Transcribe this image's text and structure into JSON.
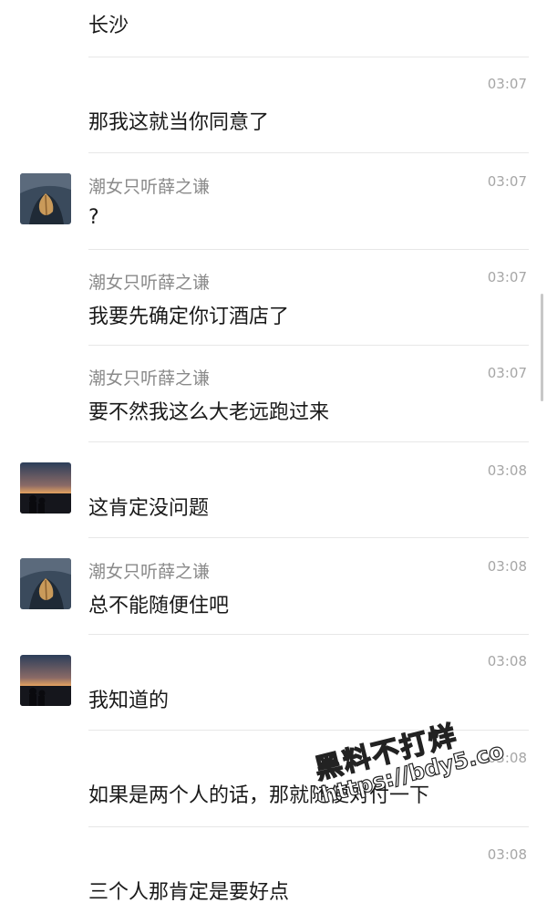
{
  "messages": [
    {
      "id": "m1",
      "avatar": "",
      "name": "",
      "time": "",
      "text": "长沙"
    },
    {
      "id": "m2",
      "avatar": "",
      "name": "",
      "time": "03:07",
      "text": "那我这就当你同意了"
    },
    {
      "id": "m3",
      "avatar": "leaf",
      "name": "潮女只听薛之谦",
      "time": "03:07",
      "text": "?"
    },
    {
      "id": "m4",
      "avatar": "",
      "name": "潮女只听薛之谦",
      "time": "03:07",
      "text": "我要先确定你订酒店了"
    },
    {
      "id": "m5",
      "avatar": "",
      "name": "潮女只听薛之谦",
      "time": "03:07",
      "text": "要不然我这么大老远跑过来"
    },
    {
      "id": "m6",
      "avatar": "sunset",
      "name": "",
      "time": "03:08",
      "text": "这肯定没问题"
    },
    {
      "id": "m7",
      "avatar": "leaf",
      "name": "潮女只听薛之谦",
      "time": "03:08",
      "text": "总不能随便住吧"
    },
    {
      "id": "m8",
      "avatar": "sunset",
      "name": "",
      "time": "03:08",
      "text": "我知道的"
    },
    {
      "id": "m9",
      "avatar": "",
      "name": "",
      "time": "03:08",
      "text": "如果是两个人的话，那就随便对付一下"
    },
    {
      "id": "m10",
      "avatar": "",
      "name": "",
      "time": "03:08",
      "text": "三个人那肯定是要好点"
    }
  ],
  "watermark": {
    "line1": "黑料不打烊",
    "line2": "https://bdy5.co"
  }
}
